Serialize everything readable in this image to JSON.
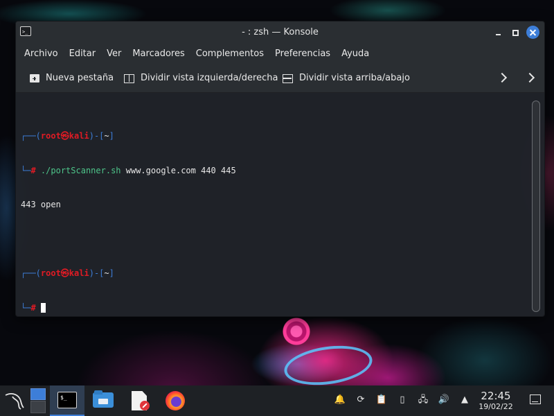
{
  "window": {
    "title": "- : zsh — Konsole"
  },
  "menubar": {
    "items": [
      "Archivo",
      "Editar",
      "Ver",
      "Marcadores",
      "Complementos",
      "Preferencias",
      "Ayuda"
    ]
  },
  "toolbar": {
    "new_tab": "Nueva pestaña",
    "split_lr": "Dividir vista izquierda/derecha",
    "split_tb": "Dividir vista arriba/abajo"
  },
  "terminal": {
    "prompt1_open": "┌──(",
    "prompt1_user": "root㉿kali",
    "prompt1_close": ")-[",
    "prompt1_path": "~",
    "prompt1_end": "]",
    "prompt1_hash_prefix": "└─",
    "prompt1_hash": "#",
    "command1": "./portScanner.sh",
    "command1_args": " www.google.com 440 445",
    "output1": "443 open",
    "prompt2_open": "┌──(",
    "prompt2_user": "root㉿kali",
    "prompt2_close": ")-[",
    "prompt2_path": "~",
    "prompt2_end": "]",
    "prompt2_hash_prefix": "└─",
    "prompt2_hash": "#"
  },
  "taskbar": {
    "clock_time": "22:45",
    "clock_date": "19/02/22"
  },
  "colors": {
    "accent": "#3d7ed8",
    "prompt_red": "#e01b24",
    "command_green": "#4ec58a"
  }
}
